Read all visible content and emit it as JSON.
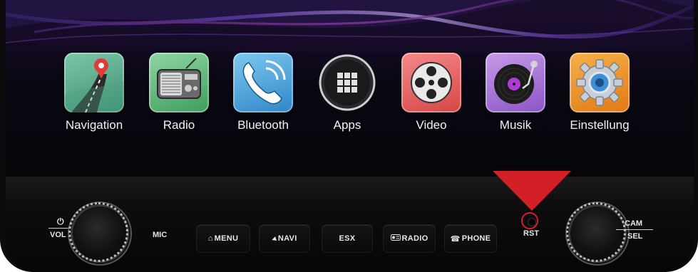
{
  "apps": [
    {
      "label": "Navigation",
      "icon": "navigation-map-pin-icon"
    },
    {
      "label": "Radio",
      "icon": "radio-icon"
    },
    {
      "label": "Bluetooth",
      "icon": "phone-bluetooth-icon"
    },
    {
      "label": "Apps",
      "icon": "apps-grid-icon"
    },
    {
      "label": "Video",
      "icon": "film-reel-icon"
    },
    {
      "label": "Musik",
      "icon": "turntable-icon"
    },
    {
      "label": "Einstellung",
      "icon": "gear-settings-icon"
    }
  ],
  "hardware": {
    "power_symbol": "⏻",
    "vol": "VOL",
    "mic": "MIC",
    "menu": "MENU",
    "menu_icon": "⌂",
    "navi": "NAVI",
    "navi_icon": "◀",
    "esx": "ESX",
    "radio": "RADIO",
    "phone": "PHONE",
    "phone_icon": "☎",
    "rst": "RST",
    "cam": "CAM",
    "sel": "SEL"
  },
  "colors": {
    "indicator_red": "#d32027",
    "bezel": "#0b0b0d"
  }
}
